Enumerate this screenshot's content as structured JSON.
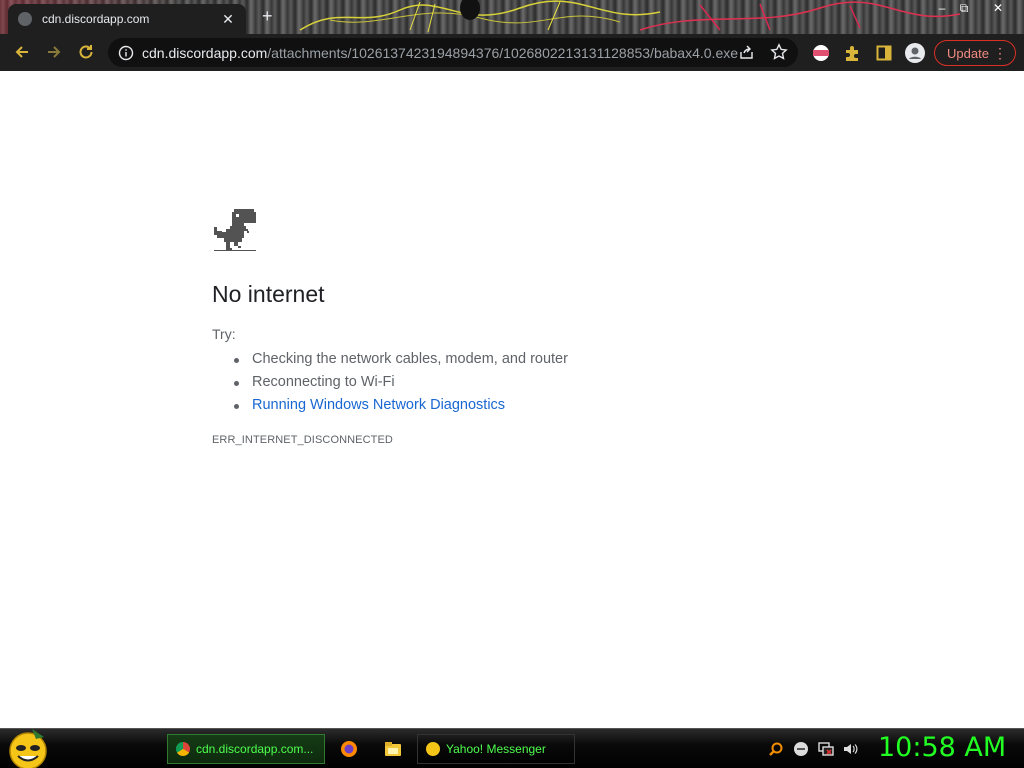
{
  "browser": {
    "tab": {
      "title": "cdn.discordapp.com"
    },
    "url": {
      "host": "cdn.discordapp.com",
      "path": "/attachments/1026137423194894376/1026802213131128853/babax4.0.exe"
    },
    "update_label": "Update"
  },
  "error_page": {
    "heading": "No internet",
    "try_label": "Try:",
    "suggestions": [
      "Checking the network cables, modem, and router",
      "Reconnecting to Wi-Fi",
      "Running Windows Network Diagnostics"
    ],
    "error_code": "ERR_INTERNET_DISCONNECTED"
  },
  "taskbar": {
    "tasks": [
      {
        "label": "cdn.discordapp.com..."
      },
      {
        "label": "Yahoo! Messenger"
      }
    ],
    "clock": "10:58 AM"
  },
  "colors": {
    "link": "#1967d2",
    "update_border": "#d93025",
    "taskbar_text": "#4dff4d",
    "clock": "#22ff22"
  }
}
